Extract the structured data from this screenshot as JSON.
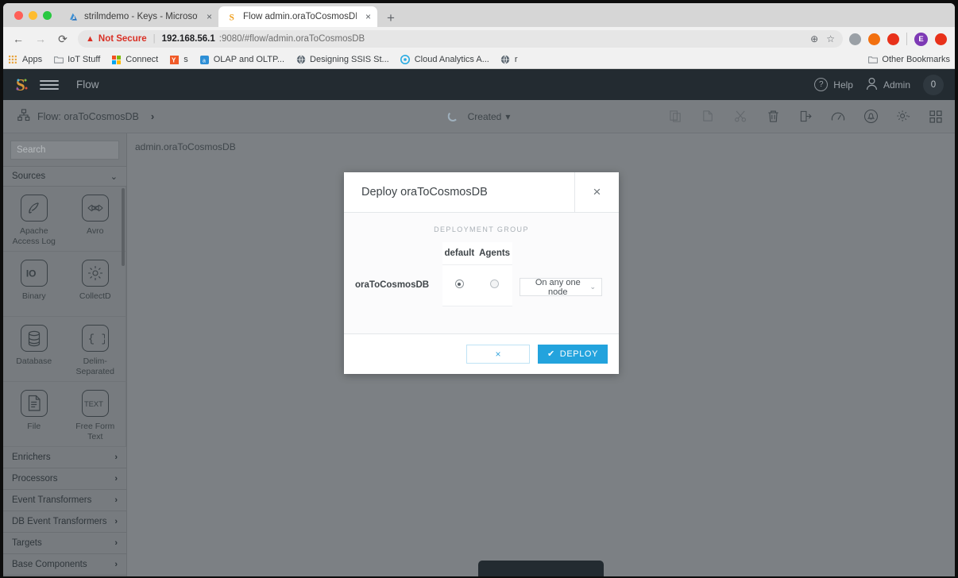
{
  "browser": {
    "tabs": [
      {
        "title": "strilmdemo - Keys - Microsoft ",
        "favicon": "azure-icon",
        "close": "×",
        "active": false
      },
      {
        "title": "Flow admin.oraToCosmosDB",
        "favicon": "striim-icon",
        "close": "×",
        "active": true
      }
    ],
    "new_tab_label": "+",
    "nav": {
      "back": "←",
      "forward": "→",
      "reload": "⟳"
    },
    "url": {
      "not_secure": "Not Secure",
      "separator": "|",
      "host": "192.168.56.1",
      "rest": ":9080/#flow/admin.oraToCosmosDB",
      "zoom_icon": "⊕",
      "star_icon": "☆"
    },
    "profile_initial": "E",
    "bookmarks": [
      {
        "label": "Apps",
        "icon": "apps-grid-icon"
      },
      {
        "label": "IoT Stuff",
        "icon": "folder-icon"
      },
      {
        "label": "Connect",
        "icon": "microsoft-icon"
      },
      {
        "label": "s",
        "icon": "yammer-icon"
      },
      {
        "label": "OLAP and OLTP...",
        "icon": "blue-doc-icon"
      },
      {
        "label": "Designing SSIS St...",
        "icon": "globe-icon"
      },
      {
        "label": "Cloud Analytics A...",
        "icon": "circle-icon"
      },
      {
        "label": "r",
        "icon": "globe-icon"
      }
    ],
    "other_bookmarks": "Other Bookmarks"
  },
  "appbar": {
    "logo": "striim-logo",
    "menu_icon": "hamburger-icon",
    "title": "Flow",
    "help_label": "Help",
    "help_icon": "question-circle-icon",
    "user_label": "Admin",
    "user_icon": "person-icon",
    "count": "0"
  },
  "toolbar": {
    "breadcrumb_icon": "flow-nodes-icon",
    "breadcrumb": "Flow: oraToCosmosDB",
    "breadcrumb_chevron": "›",
    "status": "Created",
    "status_caret": "▾",
    "icons": [
      {
        "name": "paste-icon",
        "disabled": true
      },
      {
        "name": "copy-icon",
        "disabled": true
      },
      {
        "name": "cut-scissors-icon",
        "disabled": true
      },
      {
        "name": "trash-icon",
        "disabled": false
      },
      {
        "name": "export-icon",
        "disabled": false
      },
      {
        "name": "gauge-icon",
        "disabled": false
      },
      {
        "name": "alert-bell-icon",
        "disabled": false
      },
      {
        "name": "settings-gear-icon",
        "disabled": false
      },
      {
        "name": "apps-grid-icon",
        "disabled": false
      }
    ]
  },
  "sidebar": {
    "search_placeholder": "Search",
    "sources_label": "Sources",
    "sources_chevron": "⌄",
    "components": [
      {
        "label": "Apache Access Log",
        "icon": "feather-quill-icon"
      },
      {
        "label": "Avro",
        "icon": "avro-icon"
      },
      {
        "label": "Binary",
        "icon": "binary-io-icon"
      },
      {
        "label": "CollectD",
        "icon": "collectd-sun-icon"
      },
      {
        "label": "Database",
        "icon": "database-cylinder-icon"
      },
      {
        "label": "Delim-Separated",
        "icon": "braces-icon"
      },
      {
        "label": "File",
        "icon": "file-lines-icon"
      },
      {
        "label": "Free Form Text",
        "icon": "text-icon"
      }
    ],
    "sections": [
      {
        "label": "Enrichers",
        "chevron": "›"
      },
      {
        "label": "Processors",
        "chevron": "›"
      },
      {
        "label": "Event Transformers",
        "chevron": "›"
      },
      {
        "label": "DB Event Transformers",
        "chevron": "›"
      },
      {
        "label": "Targets",
        "chevron": "›"
      },
      {
        "label": "Base Components",
        "chevron": "›"
      }
    ]
  },
  "canvas": {
    "flow_label": "admin.oraToCosmosDB"
  },
  "modal": {
    "title": "Deploy oraToCosmosDB",
    "close": "×",
    "group_label": "DEPLOYMENT GROUP",
    "columns": [
      "default",
      "Agents"
    ],
    "rows": [
      {
        "name": "oraToCosmosDB",
        "default_selected": true,
        "agents_selected": false,
        "placement": "On any one node",
        "placement_caret": "⌄"
      }
    ],
    "cancel_label": "×",
    "deploy_label": "DEPLOY",
    "deploy_check": "✔",
    "accent": "#23a3dd"
  }
}
